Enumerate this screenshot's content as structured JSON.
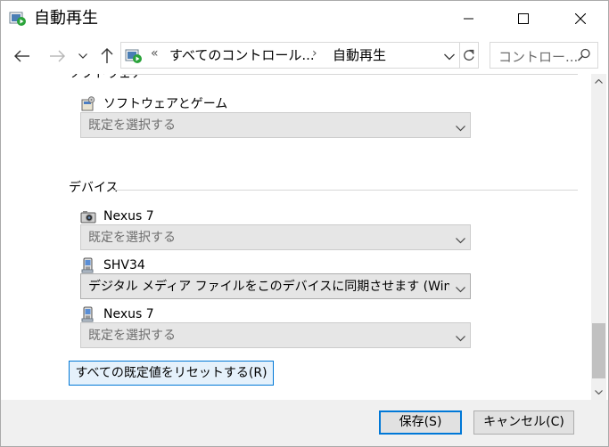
{
  "window": {
    "title": "自動再生"
  },
  "nav": {
    "back_icon": "arrow-left-icon",
    "forward_icon": "arrow-right-icon",
    "recent_icon": "chevron-down-icon",
    "up_icon": "arrow-up-icon",
    "address_prefix": "«",
    "address_part1": "すべてのコントロール...",
    "address_sep": "›",
    "address_part2": "自動再生",
    "search_placeholder": "コントロー..."
  },
  "software_group": {
    "label": "ソフトウェア",
    "items": [
      {
        "label": "ソフトウェアとゲーム",
        "value": "既定を選択する"
      }
    ]
  },
  "devices_group": {
    "label": "デバイス",
    "items": [
      {
        "label": "Nexus 7",
        "value": "既定を選択する"
      },
      {
        "label": "SHV34",
        "value": "デジタル メディア ファイルをこのデバイスに同期させます (Windows Media Player)"
      },
      {
        "label": "Nexus 7",
        "value": "既定を選択する"
      }
    ]
  },
  "reset_button": "すべての既定値をリセットする(R)",
  "footer": {
    "save": "保存(S)",
    "cancel": "キャンセル(C)"
  }
}
